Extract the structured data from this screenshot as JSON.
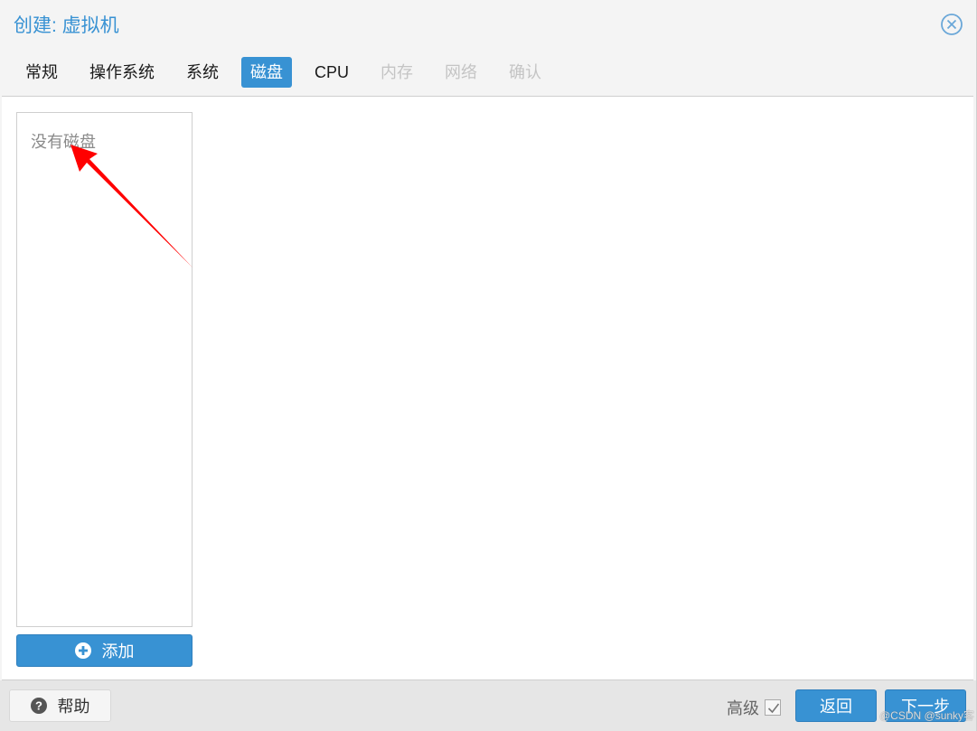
{
  "window": {
    "title": "创建: 虚拟机",
    "close_icon": "close-circle-icon"
  },
  "tabs": [
    {
      "label": "常规",
      "state": "normal"
    },
    {
      "label": "操作系统",
      "state": "normal"
    },
    {
      "label": "系统",
      "state": "normal"
    },
    {
      "label": "磁盘",
      "state": "active"
    },
    {
      "label": "CPU",
      "state": "normal"
    },
    {
      "label": "内存",
      "state": "disabled"
    },
    {
      "label": "网络",
      "state": "disabled"
    },
    {
      "label": "确认",
      "state": "disabled"
    }
  ],
  "disk_panel": {
    "empty_text": "没有磁盘",
    "add_label": "添加",
    "add_icon": "plus-circle-icon"
  },
  "footer": {
    "help_label": "帮助",
    "help_icon": "question-circle-icon",
    "advanced_label": "高级",
    "advanced_checked": true,
    "back_label": "返回",
    "next_label": "下一步"
  },
  "annotation": {
    "arrow_color": "#ff0000"
  },
  "watermark": "@CSDN @sunky客",
  "colors": {
    "accent": "#3892d3",
    "disabled_text": "#c4c4c4"
  }
}
